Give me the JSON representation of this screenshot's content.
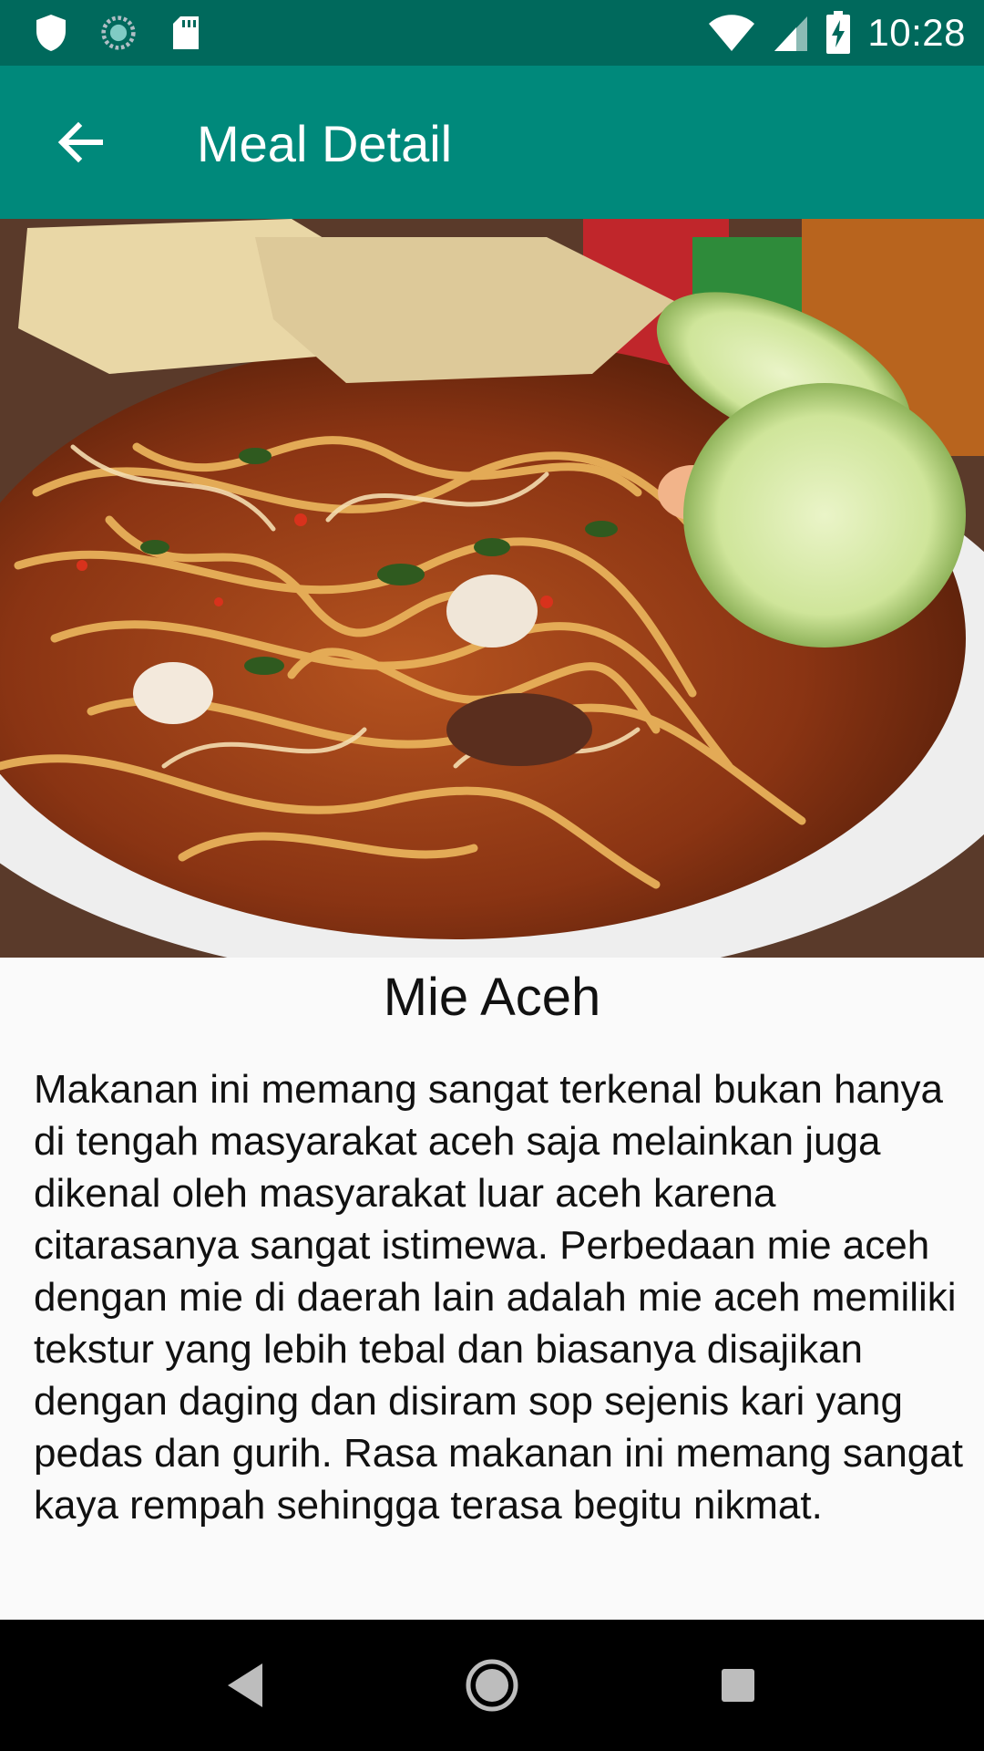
{
  "status_bar": {
    "time": "10:28",
    "icons": [
      "shield-icon",
      "sync-icon",
      "sd-card-icon",
      "wifi-icon",
      "cell-signal-icon",
      "battery-charging-icon"
    ]
  },
  "app_bar": {
    "title": "Meal Detail",
    "back_icon": "arrow-back-icon"
  },
  "hero_image": {
    "subject": "Mie Aceh"
  },
  "meal": {
    "name": "Mie Aceh",
    "description": "Makanan ini memang sangat terkenal bukan hanya di tengah masyarakat aceh saja melainkan juga dikenal oleh masyarakat luar aceh karena citarasanya sangat istimewa. Perbedaan mie aceh dengan mie di daerah lain adalah mie aceh memiliki tekstur yang lebih tebal dan biasanya disajikan dengan daging dan disiram sop sejenis kari yang pedas dan gurih. Rasa makanan ini memang sangat kaya rempah sehingga terasa begitu nikmat."
  },
  "nav_bar": {
    "buttons": [
      "nav-back-icon",
      "nav-home-icon",
      "nav-recents-icon"
    ]
  },
  "colors": {
    "status_bar": "#00695c",
    "app_bar": "#00897b",
    "background": "#fafafa",
    "nav_bar": "#000000"
  }
}
